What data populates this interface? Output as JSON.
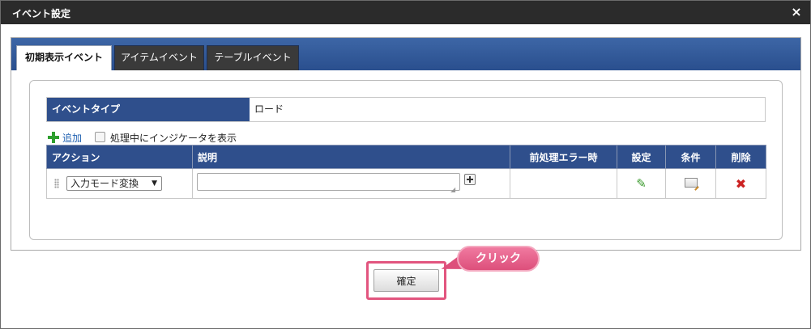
{
  "dialog": {
    "title": "イベント設定",
    "close_icon": "×"
  },
  "tabs": [
    {
      "label": "初期表示イベント",
      "active": true
    },
    {
      "label": "アイテムイベント",
      "active": false
    },
    {
      "label": "テーブルイベント",
      "active": false
    }
  ],
  "event_type": {
    "label": "イベントタイプ",
    "value": "ロード"
  },
  "toolbar": {
    "add_label": "追加",
    "indicator_label": "処理中にインジケータを表示",
    "indicator_checked": false
  },
  "table": {
    "headers": [
      "アクション",
      "説明",
      "前処理エラー時",
      "設定",
      "条件",
      "削除"
    ],
    "rows": [
      {
        "action": "入力モード変換",
        "description": "",
        "pre_error": ""
      }
    ]
  },
  "confirm_label": "確定",
  "callout_label": "クリック",
  "colors": {
    "header_blue": "#2f4f8c",
    "highlight_pink": "#e2557f",
    "add_green": "#2e9f2e",
    "delete_red": "#cc2222"
  }
}
